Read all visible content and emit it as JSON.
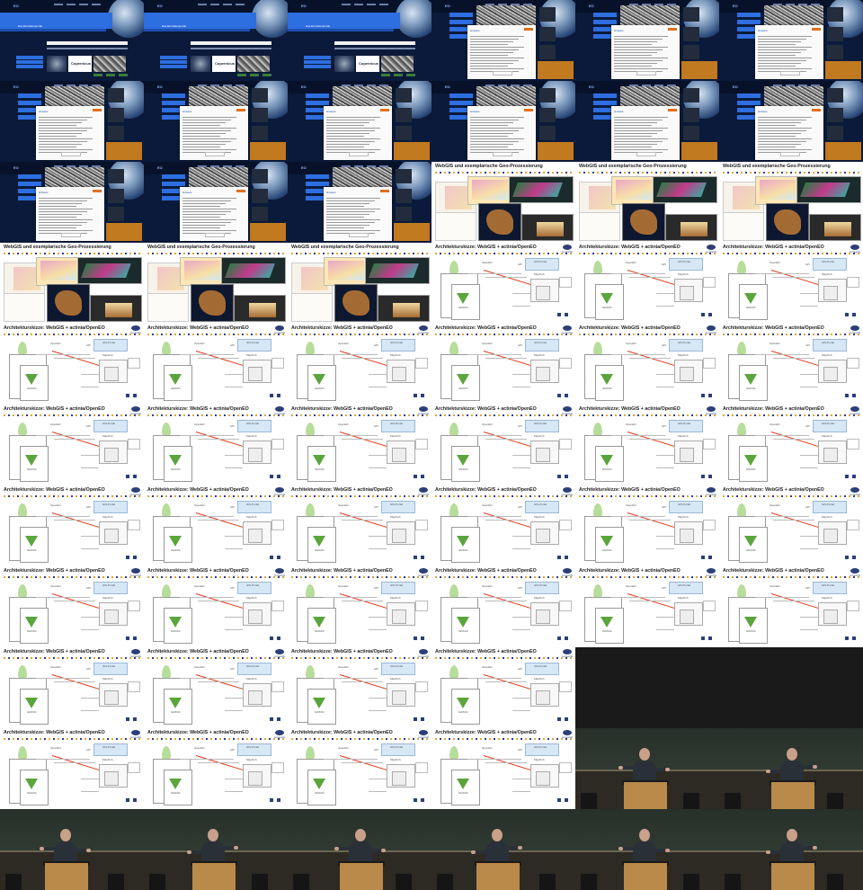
{
  "grid": {
    "columns": 6,
    "rows": 11
  },
  "eo_portal": {
    "logo_text": "EO",
    "tagline": "Das EO-Datenportal",
    "partner_logo": "Copernicus"
  },
  "dialog": {
    "title": "Hinweis"
  },
  "slides": {
    "webgis_title": "WebGIS und exemplarische Geo-Prozessierung",
    "architecture_title": "Architekturskizze: WebGIS + actinia/OpenEO",
    "brand": "terrestris",
    "labels": {
      "openeo": "OpenEO",
      "api": "API",
      "gis_portal": "GIS-Portal",
      "mapfish": "MapFish",
      "grass": "GRASS"
    }
  },
  "frames": [
    "eo",
    "eo",
    "eo",
    "eo-dialog",
    "eo-dialog",
    "eo-dialog",
    "eo-dialog",
    "eo-dialog",
    "eo-dialog",
    "eo-dialog",
    "eo-dialog",
    "eo-dialog",
    "eo-dialog",
    "eo-dialog",
    "eo-dialog",
    "webgis",
    "webgis",
    "webgis",
    "webgis",
    "webgis",
    "webgis",
    "arch",
    "arch",
    "arch",
    "arch",
    "arch",
    "arch",
    "arch",
    "arch",
    "arch",
    "arch",
    "arch",
    "arch",
    "arch",
    "arch",
    "arch",
    "arch",
    "arch",
    "arch",
    "arch",
    "arch",
    "arch",
    "arch",
    "arch",
    "arch",
    "arch",
    "arch",
    "arch",
    "arch",
    "arch",
    "arch",
    "arch",
    "blank",
    "blank",
    "arch",
    "arch",
    "arch",
    "arch",
    "video",
    "video",
    "video",
    "video",
    "video",
    "video",
    "video",
    "video"
  ]
}
